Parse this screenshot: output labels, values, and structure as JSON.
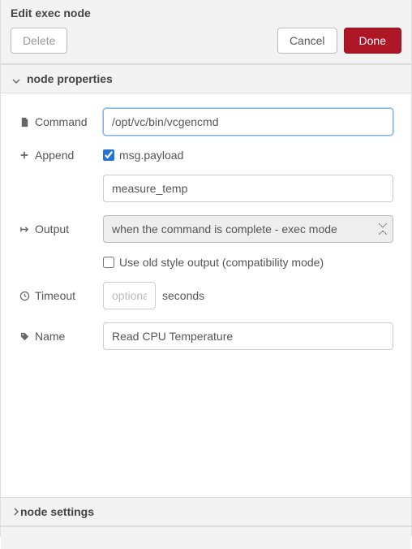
{
  "header": {
    "title": "Edit exec node",
    "delete_label": "Delete",
    "cancel_label": "Cancel",
    "done_label": "Done"
  },
  "section_properties": {
    "title": "node properties"
  },
  "form": {
    "command": {
      "label": "Command",
      "value": "/opt/vc/bin/vcgencmd"
    },
    "append": {
      "label": "Append",
      "msg_payload_checked": true,
      "msg_payload_label": "msg.payload",
      "extra_value": "measure_temp"
    },
    "output": {
      "label": "Output",
      "selected": "when the command is complete - exec mode",
      "old_style_checked": false,
      "old_style_label": "Use old style output (compatibility mode)"
    },
    "timeout": {
      "label": "Timeout",
      "placeholder": "optional",
      "value": "",
      "unit": "seconds"
    },
    "name": {
      "label": "Name",
      "value": "Read CPU Temperature"
    }
  },
  "section_settings": {
    "title": "node settings"
  }
}
